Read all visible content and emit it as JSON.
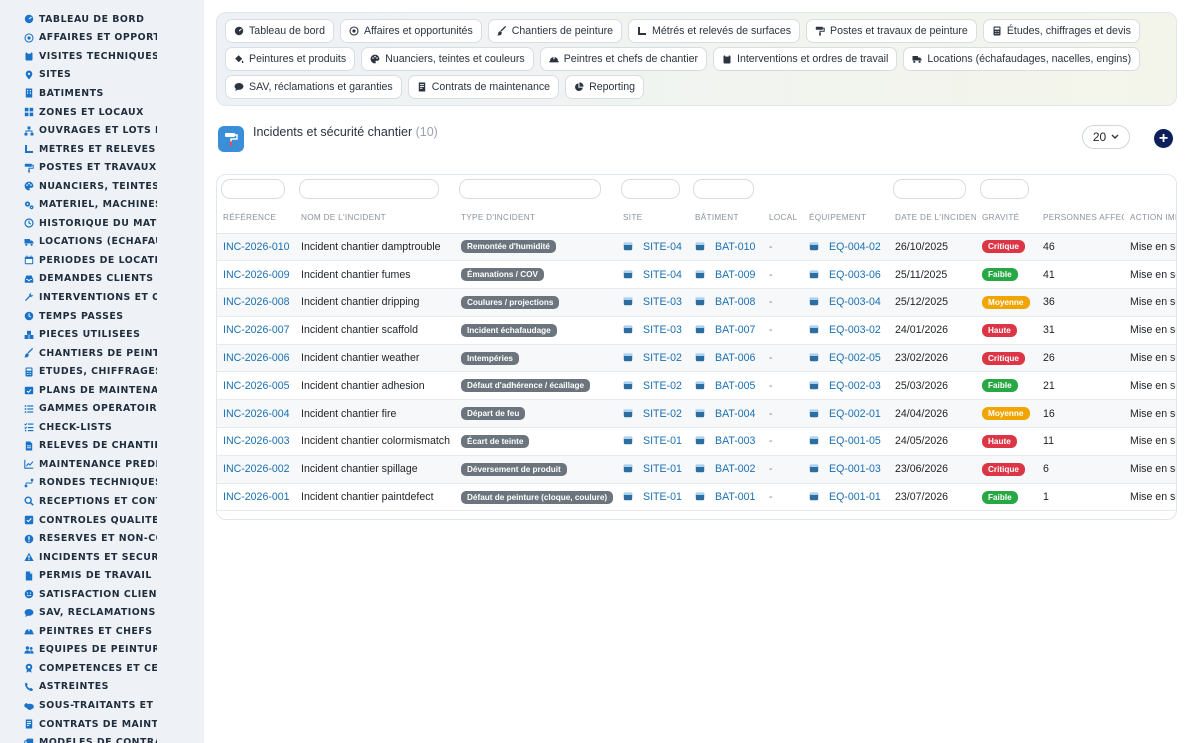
{
  "sidebar": {
    "items": [
      {
        "label": "TABLEAU DE BORD",
        "icon": "dashboard-icon"
      },
      {
        "label": "AFFAIRES ET OPPORTUNITÉS",
        "icon": "target-icon"
      },
      {
        "label": "VISITES TECHNIQUES ET DIAGNOSTICS",
        "icon": "clipboard-icon"
      },
      {
        "label": "SITES",
        "icon": "map-pin-icon"
      },
      {
        "label": "BÂTIMENTS",
        "icon": "building-icon"
      },
      {
        "label": "ZONES ET LOCAUX",
        "icon": "grid-icon"
      },
      {
        "label": "OUVRAGES ET LOTS DE TRAVAUX",
        "icon": "sitemap-icon"
      },
      {
        "label": "MÉTRÉS ET RELEVÉS DE SURFACES",
        "icon": "ruler-icon"
      },
      {
        "label": "POSTES ET TRAVAUX DE PEINTURE",
        "icon": "paint-roller-icon"
      },
      {
        "label": "NUANCIERS, TEINTES ET COULEURS",
        "icon": "palette-icon"
      },
      {
        "label": "MATÉRIEL, MACHINES ET OUTILLAGE",
        "icon": "cogs-icon"
      },
      {
        "label": "HISTORIQUE DU MATÉRIEL",
        "icon": "history-icon"
      },
      {
        "label": "LOCATIONS (ÉCHAFAUDAGES, NACELLES)",
        "icon": "truck-icon"
      },
      {
        "label": "PÉRIODES DE LOCATION",
        "icon": "calendar-icon"
      },
      {
        "label": "DEMANDES CLIENTS ET INTERVENTIONS",
        "icon": "inbox-icon"
      },
      {
        "label": "INTERVENTIONS ET ORDRES DE CHANTIER",
        "icon": "wrench-icon"
      },
      {
        "label": "TEMPS PASSÉS",
        "icon": "clock-icon"
      },
      {
        "label": "PIÈCES UTILISÉES",
        "icon": "boxes-icon"
      },
      {
        "label": "CHANTIERS DE PEINTURE",
        "icon": "brush-icon"
      },
      {
        "label": "ÉTUDES, CHIFFRAGES ET DEVIS",
        "icon": "calculator-icon"
      },
      {
        "label": "PLANS DE MAINTENANCE",
        "icon": "calendar-check-icon"
      },
      {
        "label": "GAMMES OPÉRATOIRES",
        "icon": "list-icon"
      },
      {
        "label": "CHECK-LISTS",
        "icon": "checklist-icon"
      },
      {
        "label": "RELEVÉS DE CHANTIER",
        "icon": "file-icon"
      },
      {
        "label": "MAINTENANCE PRÉDICTIVE",
        "icon": "chart-line-icon"
      },
      {
        "label": "RONDES TECHNIQUES",
        "icon": "route-icon"
      },
      {
        "label": "RÉCEPTIONS ET CONTRÔLES",
        "icon": "search-icon"
      },
      {
        "label": "CONTRÔLES QUALITÉ ET FINITIONS",
        "icon": "check-square-icon"
      },
      {
        "label": "RÉSERVES ET NON-CONFORMITÉS",
        "icon": "alert-circle-icon"
      },
      {
        "label": "INCIDENTS ET SÉCURITÉ CHANTIER",
        "icon": "warning-icon"
      },
      {
        "label": "PERMIS DE TRAVAIL",
        "icon": "document-icon"
      },
      {
        "label": "SATISFACTION CLIENT",
        "icon": "smile-icon"
      },
      {
        "label": "SAV, RÉCLAMATIONS ET GARANTIES",
        "icon": "comment-icon"
      },
      {
        "label": "PEINTRES ET CHEFS DE CHANTIER",
        "icon": "hard-hat-icon"
      },
      {
        "label": "ÉQUIPES DE PEINTURE",
        "icon": "users-icon"
      },
      {
        "label": "COMPÉTENCES ET CERTIFICATIONS",
        "icon": "certificate-icon"
      },
      {
        "label": "ASTREINTES",
        "icon": "phone-icon"
      },
      {
        "label": "SOUS-TRAITANTS ET FOURNISSEURS",
        "icon": "handshake-icon"
      },
      {
        "label": "CONTRATS DE MAINTENANCE",
        "icon": "contract-icon"
      },
      {
        "label": "MODÈLES DE CONTRATS",
        "icon": "copy-icon"
      }
    ]
  },
  "quicklinks": [
    {
      "label": "Tableau de bord",
      "icon": "dashboard-icon"
    },
    {
      "label": "Affaires et opportunités",
      "icon": "target-icon"
    },
    {
      "label": "Chantiers de peinture",
      "icon": "brush-icon"
    },
    {
      "label": "Métrés et relevés de surfaces",
      "icon": "ruler-icon"
    },
    {
      "label": "Postes et travaux de peinture",
      "icon": "paint-roller-icon"
    },
    {
      "label": "Études, chiffrages et devis",
      "icon": "calculator-icon"
    },
    {
      "label": "Peintures et produits",
      "icon": "fill-icon"
    },
    {
      "label": "Nuanciers, teintes et couleurs",
      "icon": "palette-icon"
    },
    {
      "label": "Peintres et chefs de chantier",
      "icon": "hard-hat-icon"
    },
    {
      "label": "Interventions et ordres de travail",
      "icon": "clipboard-icon"
    },
    {
      "label": "Locations (échafaudages, nacelles, engins)",
      "icon": "truck-icon"
    },
    {
      "label": "SAV, réclamations et garanties",
      "icon": "comment-icon"
    },
    {
      "label": "Contrats de maintenance",
      "icon": "contract-icon"
    },
    {
      "label": "Reporting",
      "icon": "pie-chart-icon"
    }
  ],
  "list": {
    "title": "Incidents et sécurité chantier",
    "count": "(10)",
    "page_size": "20",
    "add_label": "+",
    "columns": [
      "RÉFÉRENCE",
      "NOM DE L'INCIDENT",
      "TYPE D'INCIDENT",
      "SITE",
      "BÂTIMENT",
      "LOCAL",
      "ÉQUIPEMENT",
      "DATE DE L'INCIDENT",
      "GRAVITÉ",
      "PERSONNES AFFECTÉES",
      "ACTION IMMÉDIATE"
    ],
    "rows": [
      {
        "ref": "INC-2026-010",
        "name": "Incident chantier damptrouble",
        "type": "Remontée d'humidité",
        "site": "SITE-04",
        "bat": "BAT-010",
        "local": "-",
        "equip": "EQ-004-02",
        "date": "26/10/2025",
        "gravite": "Critique",
        "persons": "46",
        "action": "Mise en sécurité"
      },
      {
        "ref": "INC-2026-009",
        "name": "Incident chantier fumes",
        "type": "Émanations / COV",
        "site": "SITE-04",
        "bat": "BAT-009",
        "local": "-",
        "equip": "EQ-003-06",
        "date": "25/11/2025",
        "gravite": "Faible",
        "persons": "41",
        "action": "Mise en sécurité"
      },
      {
        "ref": "INC-2026-008",
        "name": "Incident chantier dripping",
        "type": "Coulures / projections",
        "site": "SITE-03",
        "bat": "BAT-008",
        "local": "-",
        "equip": "EQ-003-04",
        "date": "25/12/2025",
        "gravite": "Moyenne",
        "persons": "36",
        "action": "Mise en sécurité"
      },
      {
        "ref": "INC-2026-007",
        "name": "Incident chantier scaffold",
        "type": "Incident échafaudage",
        "site": "SITE-03",
        "bat": "BAT-007",
        "local": "-",
        "equip": "EQ-003-02",
        "date": "24/01/2026",
        "gravite": "Haute",
        "persons": "31",
        "action": "Mise en sécurité"
      },
      {
        "ref": "INC-2026-006",
        "name": "Incident chantier weather",
        "type": "Intempéries",
        "site": "SITE-02",
        "bat": "BAT-006",
        "local": "-",
        "equip": "EQ-002-05",
        "date": "23/02/2026",
        "gravite": "Critique",
        "persons": "26",
        "action": "Mise en sécurité"
      },
      {
        "ref": "INC-2026-005",
        "name": "Incident chantier adhesion",
        "type": "Défaut d'adhérence / écaillage",
        "site": "SITE-02",
        "bat": "BAT-005",
        "local": "-",
        "equip": "EQ-002-03",
        "date": "25/03/2026",
        "gravite": "Faible",
        "persons": "21",
        "action": "Mise en sécurité"
      },
      {
        "ref": "INC-2026-004",
        "name": "Incident chantier fire",
        "type": "Départ de feu",
        "site": "SITE-02",
        "bat": "BAT-004",
        "local": "-",
        "equip": "EQ-002-01",
        "date": "24/04/2026",
        "gravite": "Moyenne",
        "persons": "16",
        "action": "Mise en sécurité"
      },
      {
        "ref": "INC-2026-003",
        "name": "Incident chantier colormismatch",
        "type": "Écart de teinte",
        "site": "SITE-01",
        "bat": "BAT-003",
        "local": "-",
        "equip": "EQ-001-05",
        "date": "24/05/2026",
        "gravite": "Haute",
        "persons": "11",
        "action": "Mise en sécurité"
      },
      {
        "ref": "INC-2026-002",
        "name": "Incident chantier spillage",
        "type": "Déversement de produit",
        "site": "SITE-01",
        "bat": "BAT-002",
        "local": "-",
        "equip": "EQ-001-03",
        "date": "23/06/2026",
        "gravite": "Critique",
        "persons": "6",
        "action": "Mise en sécurité"
      },
      {
        "ref": "INC-2026-001",
        "name": "Incident chantier paintdefect",
        "type": "Défaut de peinture (cloque, coulure)",
        "site": "SITE-01",
        "bat": "BAT-001",
        "local": "-",
        "equip": "EQ-001-01",
        "date": "23/07/2026",
        "gravite": "Faible",
        "persons": "1",
        "action": "Mise en sécurité"
      }
    ]
  },
  "colors": {
    "Critique": "#dc3545",
    "Faible": "#28a745",
    "Moyenne": "#f0a500",
    "Haute": "#dc3545",
    "link": "#1a6fb3",
    "type_badge": "#6c757d",
    "add_button": "#0f1f5c"
  }
}
